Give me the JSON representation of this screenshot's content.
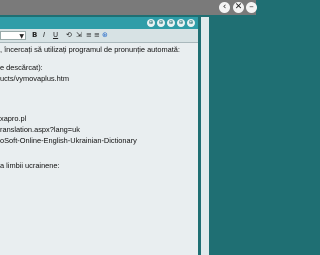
{
  "top_controls": {
    "prev_glyph": "‹",
    "close_glyph": "✕",
    "min_glyph": "–"
  },
  "panel": {
    "header_icons": [
      "⊕",
      "⊕",
      "⊕",
      "⊕",
      "⊕"
    ],
    "toolbar": {
      "select_value": "",
      "bold": "B",
      "italic": "I",
      "underline": "U",
      "buttons": [
        "⟲",
        "⇲",
        "≡",
        "≡",
        "⊛"
      ]
    },
    "lines": [
      ", încercați să utilizați programul de pronunție automată:",
      "",
      "e descărcat):",
      "ucts/vymovaplus.htm",
      "",
      "",
      "",
      "xapro.pl",
      "ranslation.aspx?lang=uk",
      "oSoft-Online-English-Ukrainian-Dictionary",
      "",
      "",
      "a limbii ucrainene:"
    ]
  }
}
